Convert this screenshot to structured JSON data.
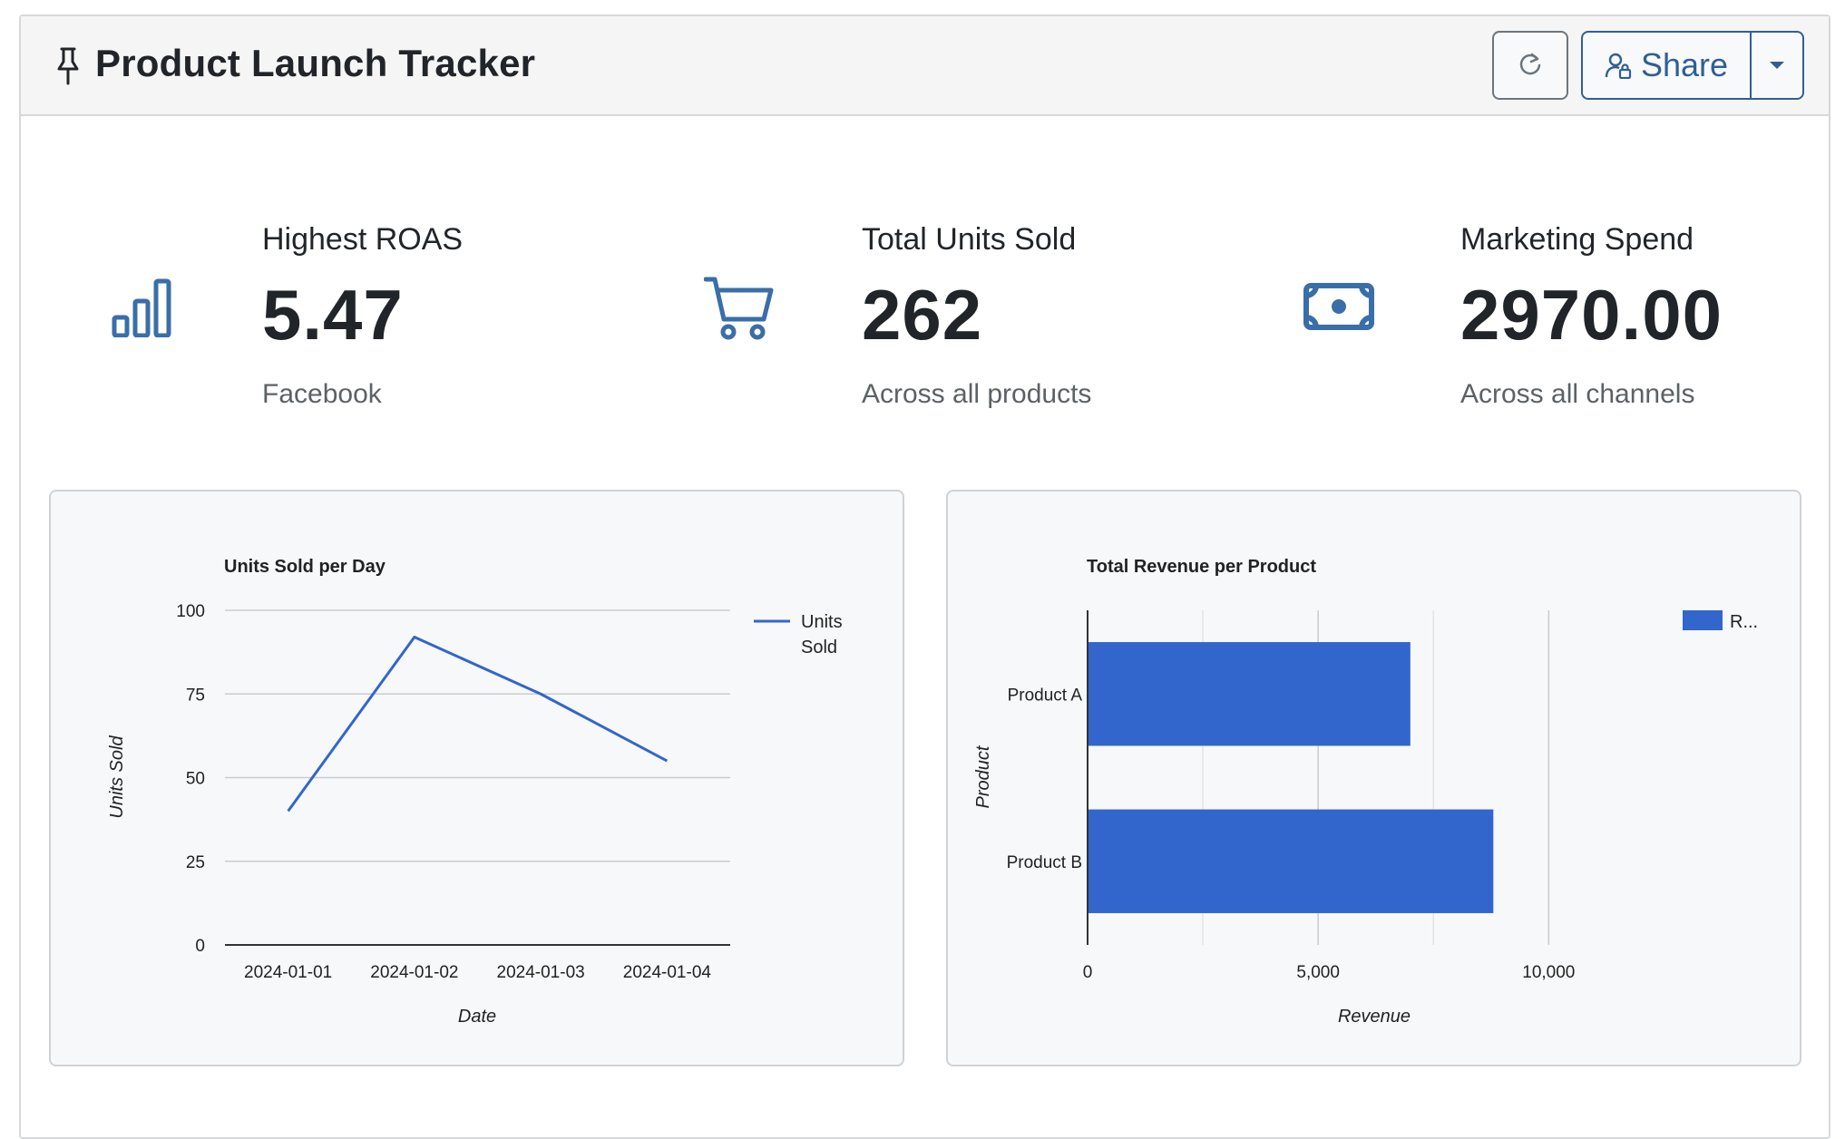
{
  "header": {
    "title": "Product Launch Tracker",
    "share_label": "Share",
    "icons": {
      "pin": "pin-icon",
      "refresh": "refresh-icon",
      "share": "user-lock-icon",
      "dropdown": "caret-down-icon"
    }
  },
  "stats": [
    {
      "label": "Highest ROAS",
      "value": "5.47",
      "sub": "Facebook",
      "icon": "bar-chart-icon"
    },
    {
      "label": "Total Units Sold",
      "value": "262",
      "sub": "Across all products",
      "icon": "cart-icon"
    },
    {
      "label": "Marketing Spend",
      "value": "2970.00",
      "sub": "Across all channels",
      "icon": "money-icon"
    }
  ],
  "colors": {
    "accent": "#2f5f95",
    "icon": "#3a6ea8",
    "series": "#3366cc",
    "grid": "#cccccc"
  },
  "chart_data": [
    {
      "type": "line",
      "title": "Units Sold per Day",
      "xlabel": "Date",
      "ylabel": "Units Sold",
      "x": [
        "2024-01-01",
        "2024-01-02",
        "2024-01-03",
        "2024-01-04"
      ],
      "series": [
        {
          "name": "Units Sold",
          "values": [
            40,
            92,
            75,
            55
          ]
        }
      ],
      "ylim": [
        0,
        100
      ],
      "yticks": [
        "0",
        "25",
        "50",
        "75",
        "100"
      ],
      "legend": "right",
      "grid": true
    },
    {
      "type": "bar",
      "orientation": "horizontal",
      "title": "Total Revenue per Product",
      "xlabel": "Revenue",
      "ylabel": "Product",
      "categories": [
        "Product A",
        "Product B"
      ],
      "series": [
        {
          "name": "R...",
          "values": [
            7000,
            8800
          ]
        }
      ],
      "xlim": [
        0,
        12000
      ],
      "xticks": [
        "0",
        "5,000",
        "10,000"
      ],
      "legend": "right",
      "grid": true
    }
  ]
}
